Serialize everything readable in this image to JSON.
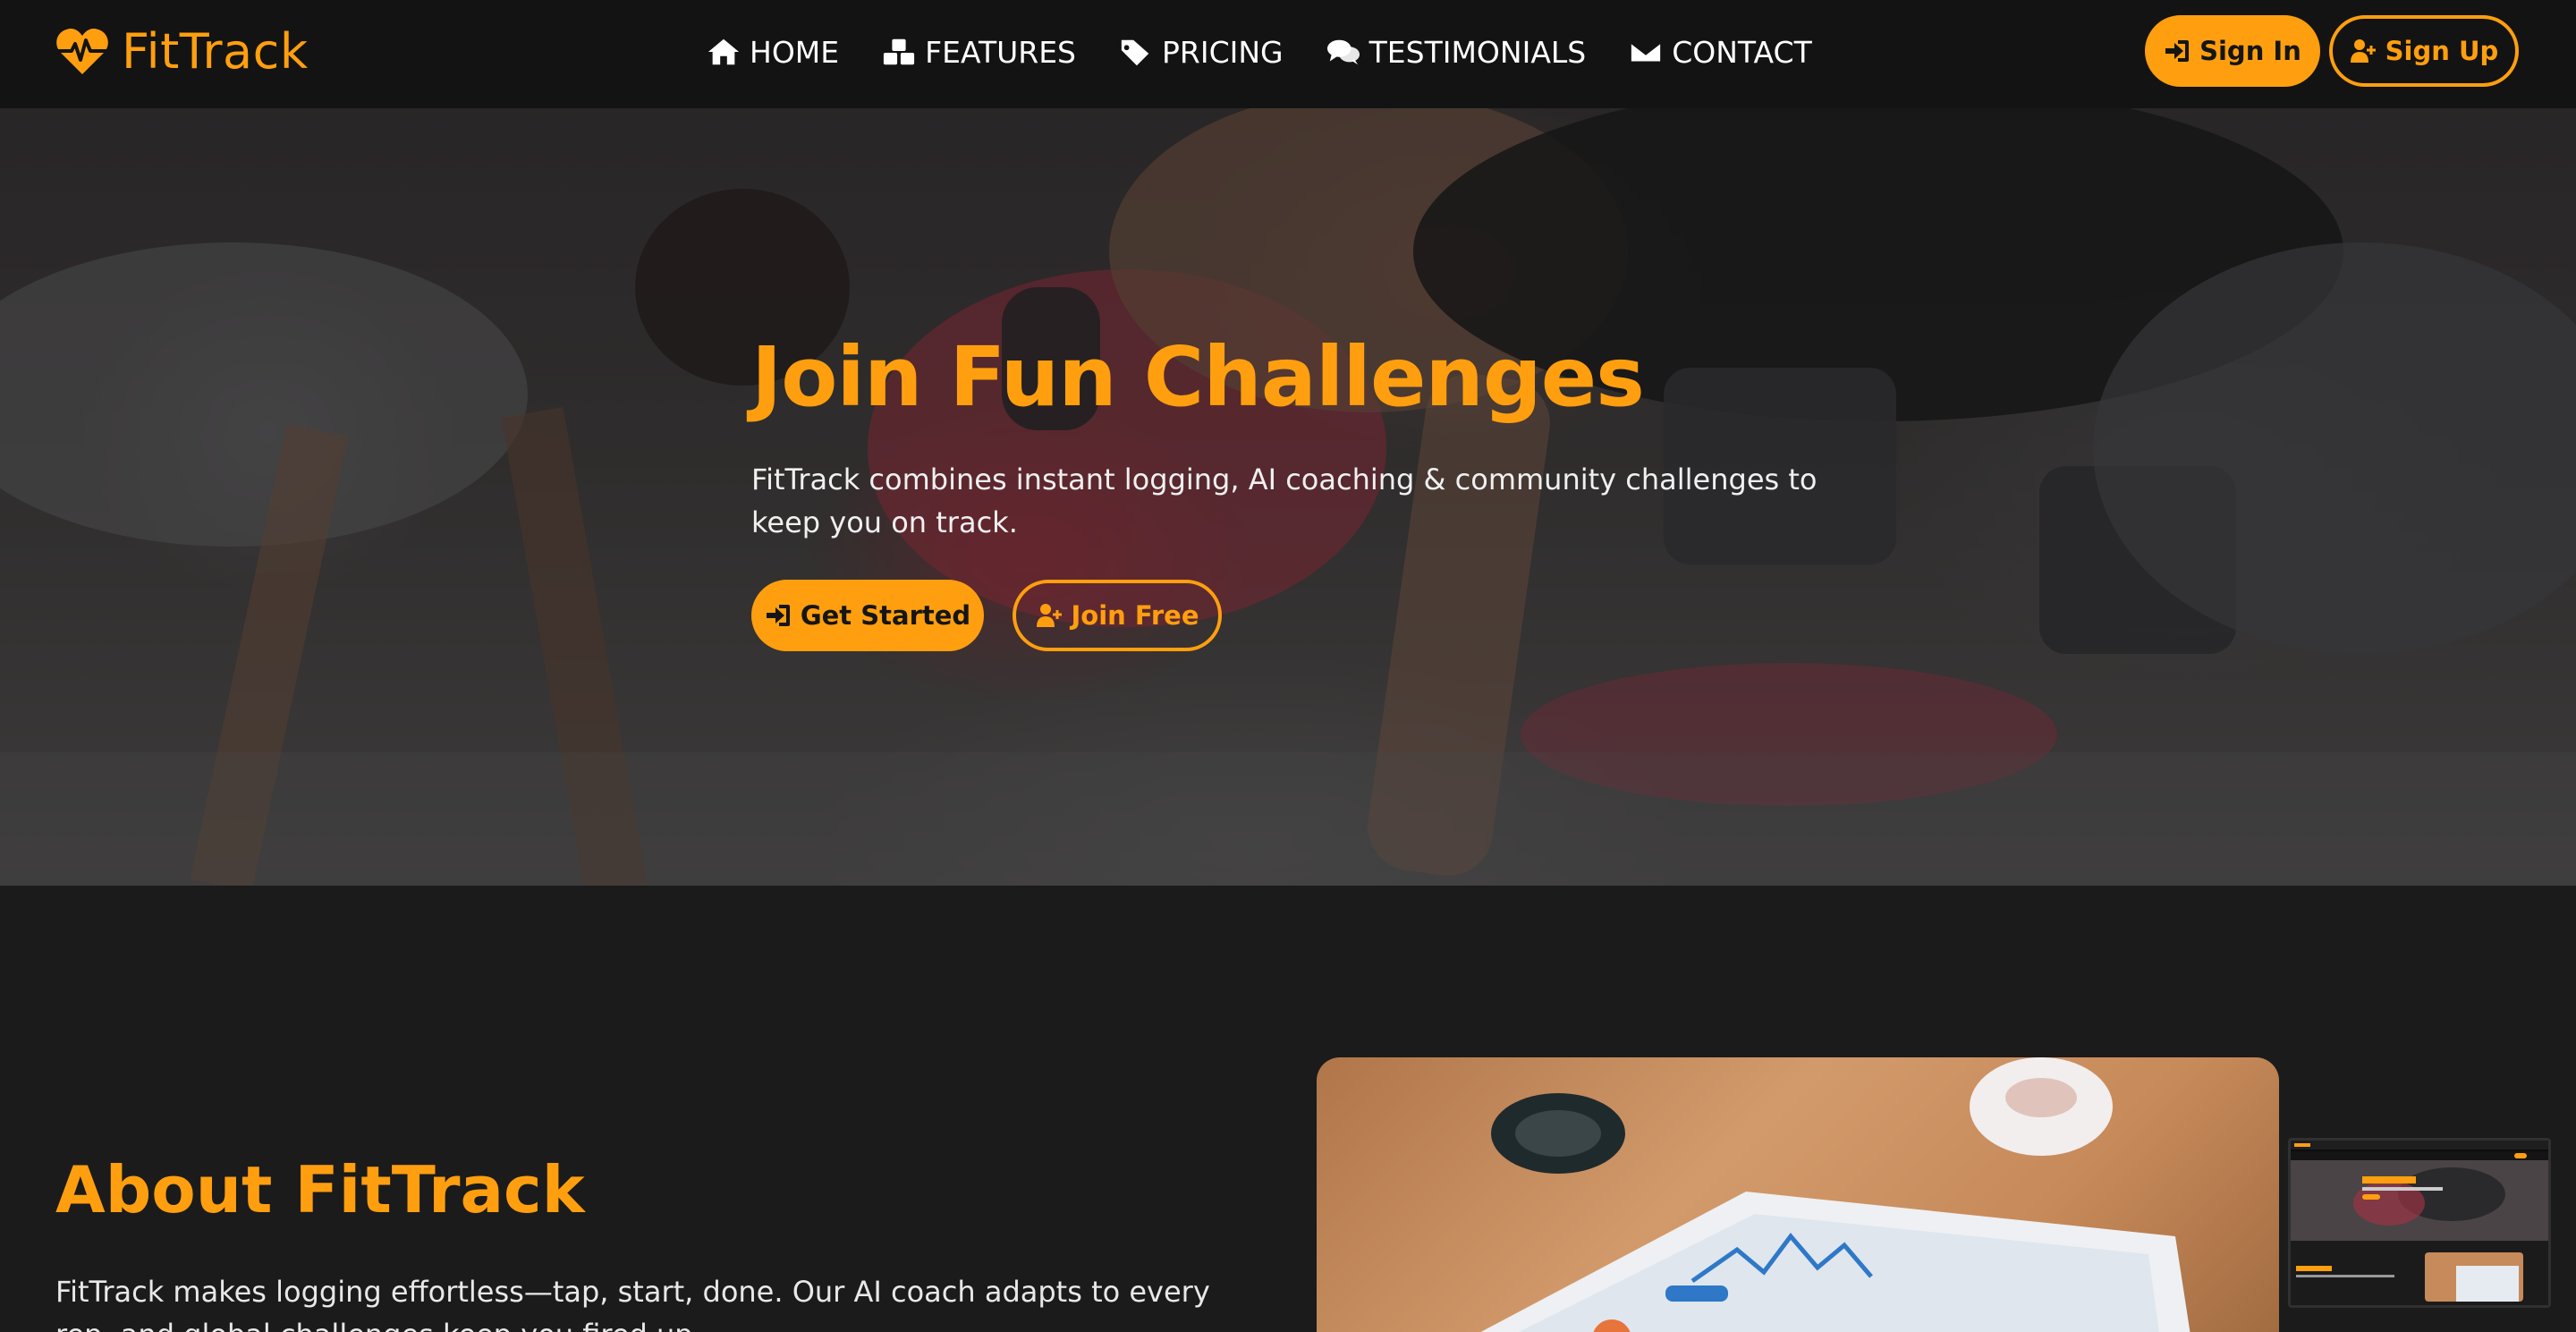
{
  "brand": {
    "name": "FitTrack",
    "icon": "heartbeat-icon",
    "accent": "#ff9f0f"
  },
  "nav": {
    "items": [
      {
        "label": "HOME",
        "icon": "home-icon"
      },
      {
        "label": "FEATURES",
        "icon": "cubes-icon"
      },
      {
        "label": "PRICING",
        "icon": "tags-icon"
      },
      {
        "label": "TESTIMONIALS",
        "icon": "comments-icon"
      },
      {
        "label": "CONTACT",
        "icon": "envelope-icon"
      }
    ],
    "sign_in": "Sign In",
    "sign_up": "Sign Up"
  },
  "hero": {
    "title": "Join Fun Challenges",
    "text": "FitTrack combines instant logging, AI coaching & community challenges to keep you on track.",
    "cta_primary": "Get Started",
    "cta_secondary": "Join Free"
  },
  "about": {
    "title": "About FitTrack",
    "text": "FitTrack makes logging effortless—tap, start, done. Our AI coach adapts to every rep, and global challenges keep you fired up."
  },
  "colors": {
    "accent": "#ff9f0f",
    "background": "#1b1b1c",
    "nav": "#131313"
  }
}
